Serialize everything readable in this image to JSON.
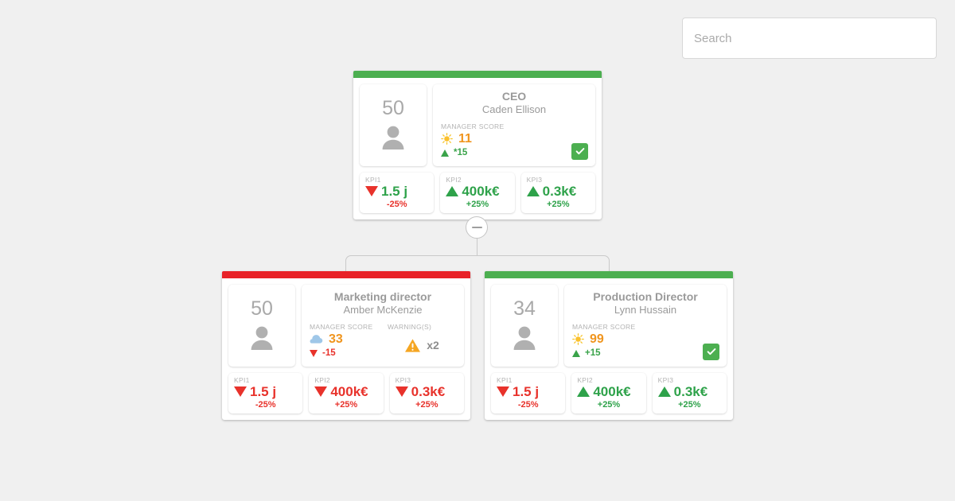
{
  "search": {
    "placeholder": "Search",
    "value": ""
  },
  "labels": {
    "manager_score": "MANAGER SCORE",
    "warnings": "WARNING(S)",
    "kpi1": "KPI1",
    "kpi2": "KPI2",
    "kpi3": "KPI3"
  },
  "colors": {
    "green": "#4caf50",
    "red": "#e82127",
    "orange": "#f0951e",
    "gray_text": "#9a9a9a",
    "amber": "#f5a623"
  },
  "nodes": [
    {
      "id": "ceo",
      "bar_color": "#4caf50",
      "headcount": "50",
      "role": "CEO",
      "person": "Caden Ellison",
      "score_icon": "sun-icon",
      "score": "11",
      "delta": "*15",
      "delta_dir": "up",
      "has_check": true,
      "warnings": null,
      "kpis": [
        {
          "label": "KPI1",
          "dir": "down",
          "value": "1.5 j",
          "value_color": "green",
          "pct": "-25%",
          "pct_color": "red"
        },
        {
          "label": "KPI2",
          "dir": "up",
          "value": "400k€",
          "value_color": "green",
          "pct": "+25%",
          "pct_color": "green"
        },
        {
          "label": "KPI3",
          "dir": "up",
          "value": "0.3k€",
          "value_color": "green",
          "pct": "+25%",
          "pct_color": "green"
        }
      ]
    },
    {
      "id": "marketing",
      "bar_color": "#e82127",
      "headcount": "50",
      "role": "Marketing director",
      "person": "Amber McKenzie",
      "score_icon": "cloud-icon",
      "score": "33",
      "delta": "-15",
      "delta_dir": "down",
      "has_check": false,
      "warnings": "x2",
      "kpis": [
        {
          "label": "KPI1",
          "dir": "down",
          "value": "1.5 j",
          "value_color": "red",
          "pct": "-25%",
          "pct_color": "red"
        },
        {
          "label": "KPI2",
          "dir": "down",
          "value": "400k€",
          "value_color": "red",
          "pct": "+25%",
          "pct_color": "red"
        },
        {
          "label": "KPI3",
          "dir": "down",
          "value": "0.3k€",
          "value_color": "red",
          "pct": "+25%",
          "pct_color": "red"
        }
      ]
    },
    {
      "id": "production",
      "bar_color": "#4caf50",
      "headcount": "34",
      "role": "Production Director",
      "person": "Lynn Hussain",
      "score_icon": "sun-icon",
      "score": "99",
      "delta": "+15",
      "delta_dir": "up",
      "has_check": true,
      "warnings": null,
      "kpis": [
        {
          "label": "KPI1",
          "dir": "down",
          "value": "1.5 j",
          "value_color": "red",
          "pct": "-25%",
          "pct_color": "red"
        },
        {
          "label": "KPI2",
          "dir": "up",
          "value": "400k€",
          "value_color": "green",
          "pct": "+25%",
          "pct_color": "green"
        },
        {
          "label": "KPI3",
          "dir": "up",
          "value": "0.3k€",
          "value_color": "green",
          "pct": "+25%",
          "pct_color": "green"
        }
      ]
    }
  ],
  "collapse_button": {
    "state": "expanded",
    "glyph": "minus"
  }
}
